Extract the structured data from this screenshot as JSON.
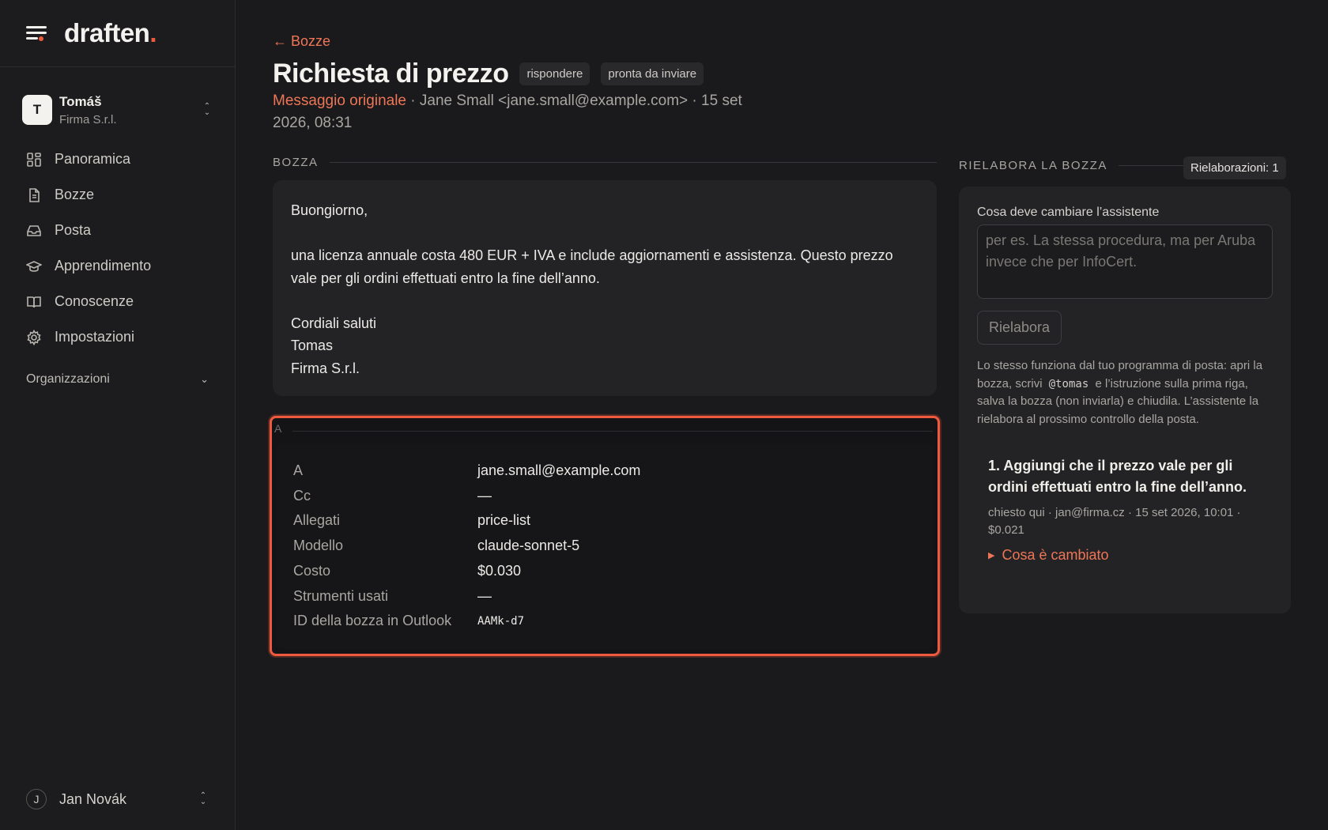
{
  "brand": {
    "name": "draften",
    "dot": "."
  },
  "account": {
    "initial": "T",
    "name": "Tomáš",
    "org": "Firma S.r.l."
  },
  "nav": [
    {
      "label": "Panoramica",
      "icon": "grid-icon"
    },
    {
      "label": "Bozze",
      "icon": "document-icon"
    },
    {
      "label": "Posta",
      "icon": "inbox-icon"
    },
    {
      "label": "Apprendimento",
      "icon": "graduation-cap-icon"
    },
    {
      "label": "Conoscenze",
      "icon": "book-icon"
    },
    {
      "label": "Impostazioni",
      "icon": "gear-icon"
    }
  ],
  "orgs_label": "Organizzazioni",
  "user": {
    "initial": "J",
    "name": "Jan Novák"
  },
  "back_label": "← Bozze",
  "title": "Richiesta di prezzo",
  "tags": [
    "rispondere",
    "pronta da inviare"
  ],
  "meta": {
    "original_link": "Messaggio originale",
    "rest": " · Jane Small <jane.small@example.com> · 15 set 2026, 08:31"
  },
  "draft_section_label": "BOZZA",
  "draft_lines": [
    "Buongiorno,",
    "",
    "una licenza annuale costa 480 EUR + IVA e include aggiornamenti e assistenza. Questo prezzo vale per gli ordini effettuati entro la fine dell’anno.",
    "",
    "Cordiali saluti",
    "Tomas",
    "Firma S.r.l."
  ],
  "details_section_label": "A",
  "details": [
    {
      "key": "A",
      "value": "jane.small@example.com"
    },
    {
      "key": "Cc",
      "value": "—"
    },
    {
      "key": "Allegati",
      "value": "price-list"
    },
    {
      "key": "Modello",
      "value": "claude-sonnet-5"
    },
    {
      "key": "Costo",
      "value": "$0.030"
    },
    {
      "key": "Strumenti usati",
      "value": "—"
    },
    {
      "key": "ID della bozza in Outlook",
      "value": "AAMk-d7"
    }
  ],
  "rework": {
    "section_label": "RIELABORA LA BOZZA",
    "badge": "Rielaborazioni: 1",
    "field_label": "Cosa deve cambiare l’assistente",
    "placeholder": "per es. La stessa procedura, ma per Aruba invece che per InfoCert.",
    "button": "Rielabora",
    "help_before": "Lo stesso funziona dal tuo programma di posta: apri la bozza, scrivi",
    "help_code": "@tomas",
    "help_after": "e l’istruzione sulla prima riga, salva la bozza (non inviarla) e chiudila. L’assistente la rielabora al prossimo controllo della posta.",
    "history": [
      {
        "title": "1. Aggiungi che il prezzo vale per gli ordini effettuati entro la fine dell’anno.",
        "meta": "chiesto qui · jan@firma.cz · 15 set 2026, 10:01 · $0.021",
        "link": "Cosa è cambiato"
      }
    ]
  },
  "colors": {
    "accent": "#ef5a3f",
    "background": "#1a1a1c",
    "card": "#232326"
  }
}
